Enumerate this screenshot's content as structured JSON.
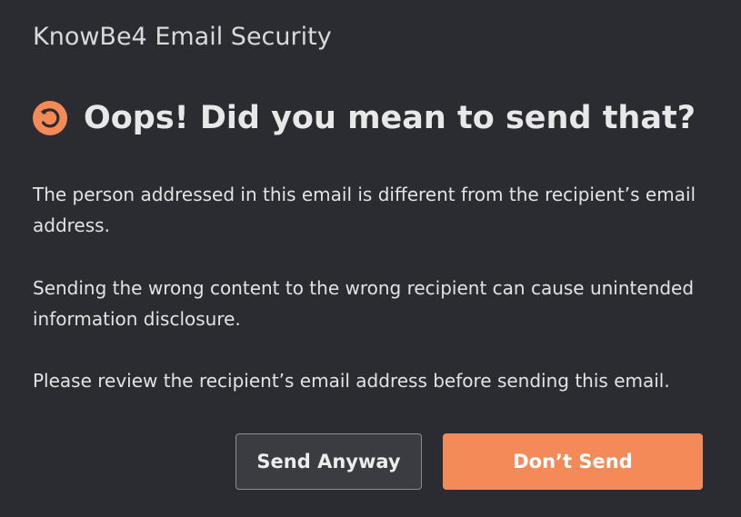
{
  "app": {
    "title": "KnowBe4 Email Security"
  },
  "dialog": {
    "icon": "warning-undo-icon",
    "title": "Oops! Did you mean to send that?",
    "paragraphs": [
      "The person addressed in this email is different from the recipient’s email address.",
      "Sending the wrong content to the wrong recipient can cause unintended information disclosure.",
      "Please review the recipient’s email address before sending this email."
    ],
    "buttons": {
      "send_anyway": "Send Anyway",
      "dont_send": "Don’t Send"
    }
  },
  "colors": {
    "background": "#2b2c31",
    "accent": "#f48a58",
    "text": "#e6e6e6",
    "secondary_button_bg": "#3b3c42",
    "secondary_button_border": "#8c8d92"
  }
}
